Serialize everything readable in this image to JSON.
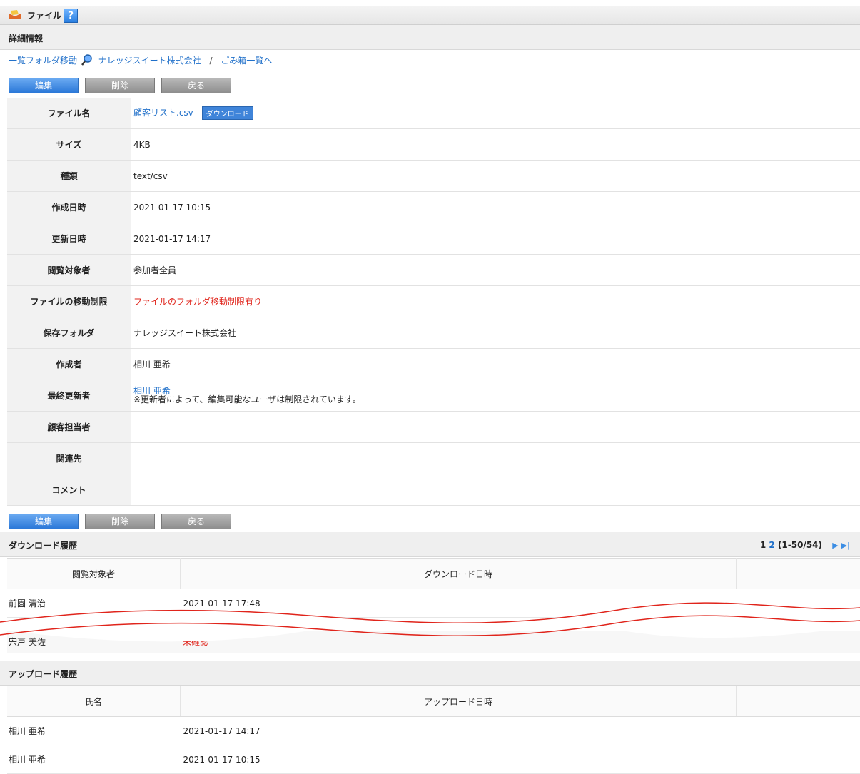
{
  "header": {
    "title": "ファイル",
    "help": "?"
  },
  "detail_section": {
    "label": "詳細情報"
  },
  "nav": {
    "folder_link": "一覧フォルダ移動",
    "company": "ナレッジスイート株式会社",
    "separator": "/",
    "trash_link": "ごみ箱一覧へ"
  },
  "buttons": {
    "edit": "編集",
    "delete": "削除",
    "back": "戻る"
  },
  "fields": {
    "file_name": {
      "label": "ファイル名",
      "value": "顧客リスト.csv",
      "download": "ダウンロード"
    },
    "size": {
      "label": "サイズ",
      "value": "4KB"
    },
    "type": {
      "label": "種類",
      "value": "text/csv"
    },
    "created": {
      "label": "作成日時",
      "value": "2021-01-17 10:15"
    },
    "updated": {
      "label": "更新日時",
      "value": "2021-01-17 14:17"
    },
    "viewers": {
      "label": "閲覧対象者",
      "value": "参加者全員"
    },
    "move_limit": {
      "label": "ファイルの移動制限",
      "value": "ファイルのフォルダ移動制限有り"
    },
    "folder": {
      "label": "保存フォルダ",
      "value": "ナレッジスイート株式会社"
    },
    "creator": {
      "label": "作成者",
      "value": "相川 亜希"
    },
    "last_updater": {
      "label": "最終更新者",
      "value": "相川 亜希",
      "note": "※更新者によって、編集可能なユーザは制限されています。"
    },
    "customer_rep": {
      "label": "顧客担当者",
      "value": ""
    },
    "related": {
      "label": "関連先",
      "value": ""
    },
    "comment": {
      "label": "コメント",
      "value": ""
    }
  },
  "download_history": {
    "label": "ダウンロード履歴",
    "pager": {
      "page1": "1",
      "page2": "2",
      "range": "(1-50/54)"
    },
    "columns": [
      "閲覧対象者",
      "ダウンロード日時"
    ],
    "rows": [
      {
        "name": "前園 清治",
        "date": "2021-01-17 17:48"
      }
    ],
    "trailing": {
      "name": "宍戸 美佐",
      "status": "未確認"
    }
  },
  "upload_history": {
    "label": "アップロード履歴",
    "columns": [
      "氏名",
      "アップロード日時"
    ],
    "rows": [
      {
        "name": "相川 亜希",
        "date": "2021-01-17 14:17"
      },
      {
        "name": "相川 亜希",
        "date": "2021-01-17 10:15"
      }
    ]
  },
  "colors": {
    "link": "#1f6fc9",
    "alert": "#e0241b",
    "primary_button": "#2b78d8"
  }
}
